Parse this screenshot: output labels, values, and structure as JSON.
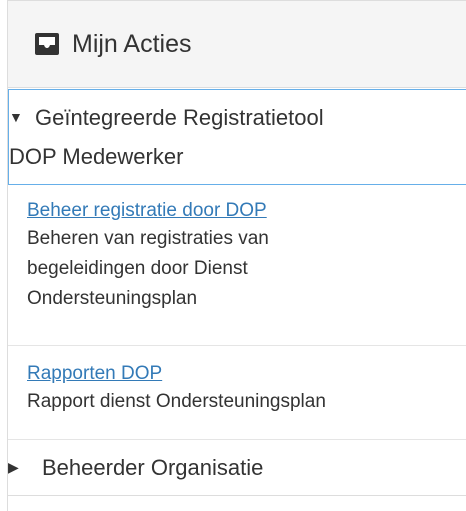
{
  "panel": {
    "title": "Mijn Acties",
    "icon": "inbox-icon"
  },
  "groups": [
    {
      "expanded": true,
      "toggle": "▼",
      "label_line1": "Geïntegreerde Registratietool",
      "label_line2": "DOP Medewerker",
      "items": [
        {
          "link": "Beheer registratie door DOP",
          "desc_lines": [
            "Beheren van registraties van",
            "begeleidingen door Dienst",
            "Ondersteuningsplan"
          ]
        },
        {
          "link": "Rapporten DOP",
          "desc_lines": [
            "Rapport dienst Ondersteuningsplan"
          ]
        }
      ]
    },
    {
      "expanded": false,
      "toggle": "▶",
      "label": "Beheerder Organisatie"
    }
  ],
  "colors": {
    "link": "#337ab7",
    "active_border": "#66afe9",
    "heading_bg": "#f5f5f5"
  }
}
